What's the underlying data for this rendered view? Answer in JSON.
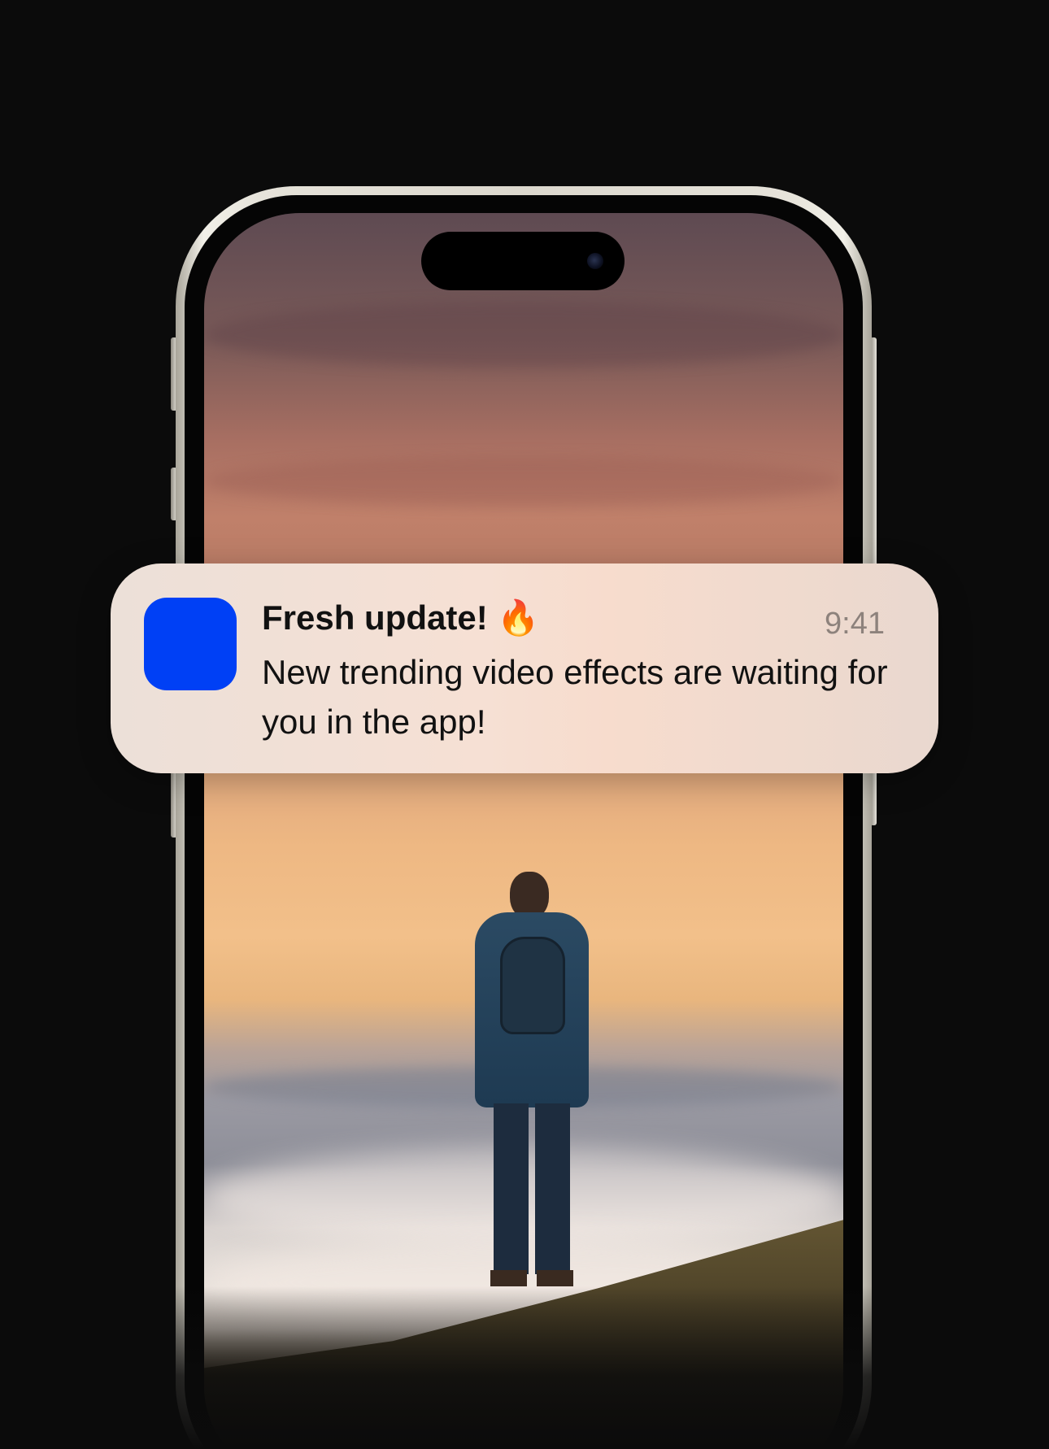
{
  "notification": {
    "title": "Fresh update! 🔥",
    "time": "9:41",
    "body": "New trending video effects are waiting for you in the app!",
    "icon_color": "#0040f5"
  },
  "colors": {
    "background": "#0b0b0b",
    "frame": "#e6e3da",
    "app_icon": "#0040f5"
  },
  "icons": {
    "app_icon": "app-icon",
    "camera": "camera-icon"
  }
}
